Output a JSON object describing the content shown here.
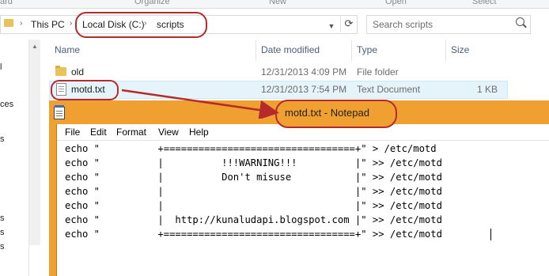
{
  "ribbon": {
    "labels": [
      "ard",
      "Organize",
      "New",
      "Open",
      "Select"
    ]
  },
  "address_bar": {
    "segments": [
      "This PC",
      "Local Disk (C:)",
      "scripts"
    ]
  },
  "search": {
    "placeholder": "Search scripts"
  },
  "nav": {
    "items": [
      "l",
      "ces",
      "s",
      "s",
      "s",
      "s"
    ]
  },
  "columns": {
    "name": "Name",
    "date": "Date modified",
    "type": "Type",
    "size": "Size"
  },
  "files": [
    {
      "name": "old",
      "date": "12/31/2013 4:09 PM",
      "type": "File folder",
      "size": "",
      "icon": "folder-icon"
    },
    {
      "name": "motd.txt",
      "date": "12/31/2013 7:54 PM",
      "type": "Text Document",
      "size": "1 KB",
      "icon": "text-file-icon"
    }
  ],
  "notepad": {
    "title": "motd.txt - Notepad",
    "menu": [
      "File",
      "Edit",
      "Format",
      "View",
      "Help"
    ],
    "lines": [
      "echo \"          +=================================+\" > /etc/motd",
      "echo \"          |          !!!WARNING!!!          |\" >> /etc/motd",
      "echo \"          |          Don't misuse           |\" >> /etc/motd",
      "echo \"          |                                 |\" >> /etc/motd",
      "echo \"          |                                 |\" >> /etc/motd",
      "echo \"          |  http://kunaludapi.blogspot.com |\" >> /etc/motd",
      "echo \"          +=================================+\" >> /etc/motd"
    ]
  },
  "colors": {
    "annotation": "#b52a2a",
    "notepad_frame": "#f0a030",
    "selection": "#e5f3fb"
  }
}
